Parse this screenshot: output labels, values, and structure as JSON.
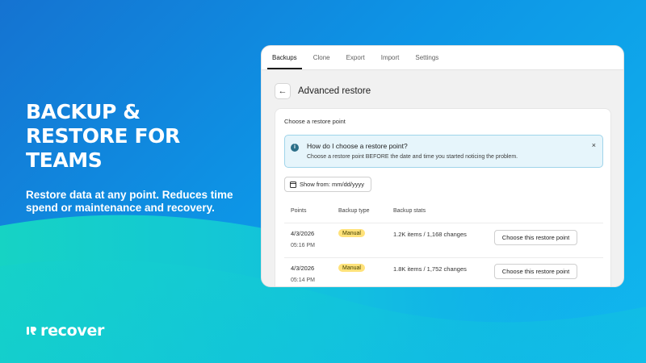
{
  "hero": {
    "title": "BACKUP & RESTORE FOR TEAMS",
    "subtitle": "Restore data at any point. Reduces time spend or maintenance and recovery."
  },
  "brand": {
    "name": "recover"
  },
  "app": {
    "tabs": [
      {
        "label": "Backups",
        "active": true
      },
      {
        "label": "Clone",
        "active": false
      },
      {
        "label": "Export",
        "active": false
      },
      {
        "label": "Import",
        "active": false
      },
      {
        "label": "Settings",
        "active": false
      }
    ],
    "page_title": "Advanced restore",
    "card_heading": "Choose a restore point",
    "banner": {
      "title": "How do I choose a restore point?",
      "text": "Choose a restore point BEFORE the date and time you started noticing the problem.",
      "close": "×"
    },
    "date_filter": {
      "label": "Show from: mm/dd/yyyy"
    },
    "table": {
      "headers": [
        "Points",
        "Backup type",
        "Backup stats"
      ],
      "rows": [
        {
          "date": "4/3/2026",
          "time": "05:16 PM",
          "type": "Manual",
          "stats": "1.2K items / 1,168 changes",
          "action": "Choose this restore point"
        },
        {
          "date": "4/3/2026",
          "time": "05:14 PM",
          "type": "Manual",
          "stats": "1.8K items / 1,752 changes",
          "action": "Choose this restore point"
        }
      ]
    }
  },
  "colors": {
    "bg_start": "#1573d1",
    "bg_end": "#11b9ee",
    "wave_teal": "#13d0c8",
    "badge": "#ffe27a",
    "banner_bg": "#e6f5fb",
    "banner_border": "#9fd4ea"
  }
}
